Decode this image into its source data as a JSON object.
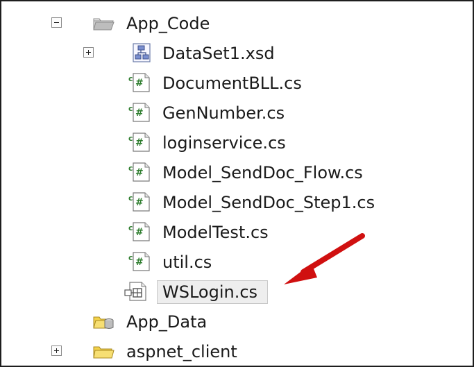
{
  "tree": {
    "app_code": {
      "label": "App_Code",
      "icon": "special-folder-icon",
      "expanded": true
    },
    "children": [
      {
        "label": "DataSet1.xsd",
        "icon": "dataset-icon",
        "expandable": true
      },
      {
        "label": "DocumentBLL.cs",
        "icon": "csharp-file-icon"
      },
      {
        "label": "GenNumber.cs",
        "icon": "csharp-file-icon"
      },
      {
        "label": "loginservice.cs",
        "icon": "csharp-file-icon"
      },
      {
        "label": "Model_SendDoc_Flow.cs",
        "icon": "csharp-file-icon"
      },
      {
        "label": "Model_SendDoc_Step1.cs",
        "icon": "csharp-file-icon"
      },
      {
        "label": "ModelTest.cs",
        "icon": "csharp-file-icon"
      },
      {
        "label": "util.cs",
        "icon": "csharp-file-icon"
      },
      {
        "label": "WSLogin.cs",
        "icon": "class-file-icon",
        "selected": true
      }
    ],
    "app_data": {
      "label": "App_Data",
      "icon": "data-folder-icon"
    },
    "aspnet_client": {
      "label": "aspnet_client",
      "icon": "folder-icon",
      "expandable": true
    }
  },
  "annotation": {
    "icon": "red-arrow-icon",
    "color": "#d01010"
  },
  "colors": {
    "cs_icon_green": "#2e7d2e",
    "folder_yellow": "#f3d24a"
  }
}
